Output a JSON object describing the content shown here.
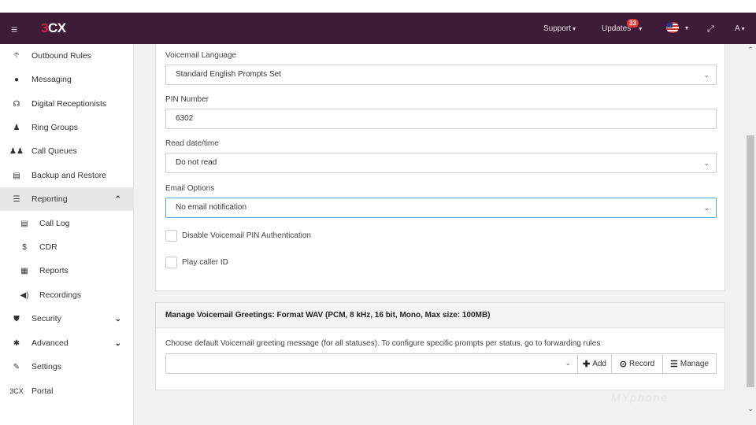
{
  "topbar": {
    "menu_icon": "≡",
    "logo_prefix": "3",
    "logo_suffix": "CX",
    "support": "Support",
    "updates": "Updates",
    "updates_badge": "33",
    "user": "A",
    "bg_color": "#3c1c36"
  },
  "sidebar": {
    "items": [
      {
        "label": "Outbound Rules",
        "icon": "arrow-up-icon",
        "glyph": "🡡"
      },
      {
        "label": "Messaging",
        "icon": "chat-bubble-icon",
        "glyph": "●"
      },
      {
        "label": "Digital Receptionists",
        "icon": "headset-icon",
        "glyph": "☊"
      },
      {
        "label": "Ring Groups",
        "icon": "users-icon",
        "glyph": "♟"
      },
      {
        "label": "Call Queues",
        "icon": "group-icon",
        "glyph": "♟♟"
      },
      {
        "label": "Backup and Restore",
        "icon": "database-icon",
        "glyph": "▤"
      },
      {
        "label": "Reporting",
        "icon": "list-icon",
        "glyph": "☰"
      },
      {
        "label": "Call Log",
        "icon": "document-icon",
        "glyph": "▤"
      },
      {
        "label": "CDR",
        "icon": "dollar-icon",
        "glyph": "$"
      },
      {
        "label": "Reports",
        "icon": "report-icon",
        "glyph": "▦"
      },
      {
        "label": "Recordings",
        "icon": "speaker-icon",
        "glyph": "◀)"
      },
      {
        "label": "Security",
        "icon": "shield-icon",
        "glyph": "⛊"
      },
      {
        "label": "Advanced",
        "icon": "gear-icon",
        "glyph": "✱"
      },
      {
        "label": "Settings",
        "icon": "wrench-icon",
        "glyph": "✎"
      },
      {
        "label": "Portal",
        "icon": "3cx-logo-icon",
        "glyph": "3CX"
      }
    ],
    "reporting_chevron": "⌃",
    "security_chevron": "⌄",
    "advanced_chevron": "⌄"
  },
  "form": {
    "voicemail_language_label": "Voicemail Language",
    "voicemail_language_value": "Standard English Prompts Set",
    "pin_label": "PIN Number",
    "pin_value": "6302",
    "read_datetime_label": "Read date/time",
    "read_datetime_value": "Do not read",
    "email_options_label": "Email Options",
    "email_options_value": "No email notification",
    "disable_pin_label": "Disable Voicemail PIN Authentication",
    "play_caller_id_label": "Play caller ID",
    "dropdown_glyph": "⌄"
  },
  "greetings": {
    "title": "Manage Voicemail Greetings: Format WAV (PCM, 8 kHz, 16 bit, Mono, Max size: 100MB)",
    "description": "Choose default Voicemail greeting message (for all statuses). To configure specific prompts per status, go to forwarding rules",
    "add_label": "Add",
    "record_label": "Record",
    "manage_label": "Manage"
  },
  "watermark": "MYphone"
}
